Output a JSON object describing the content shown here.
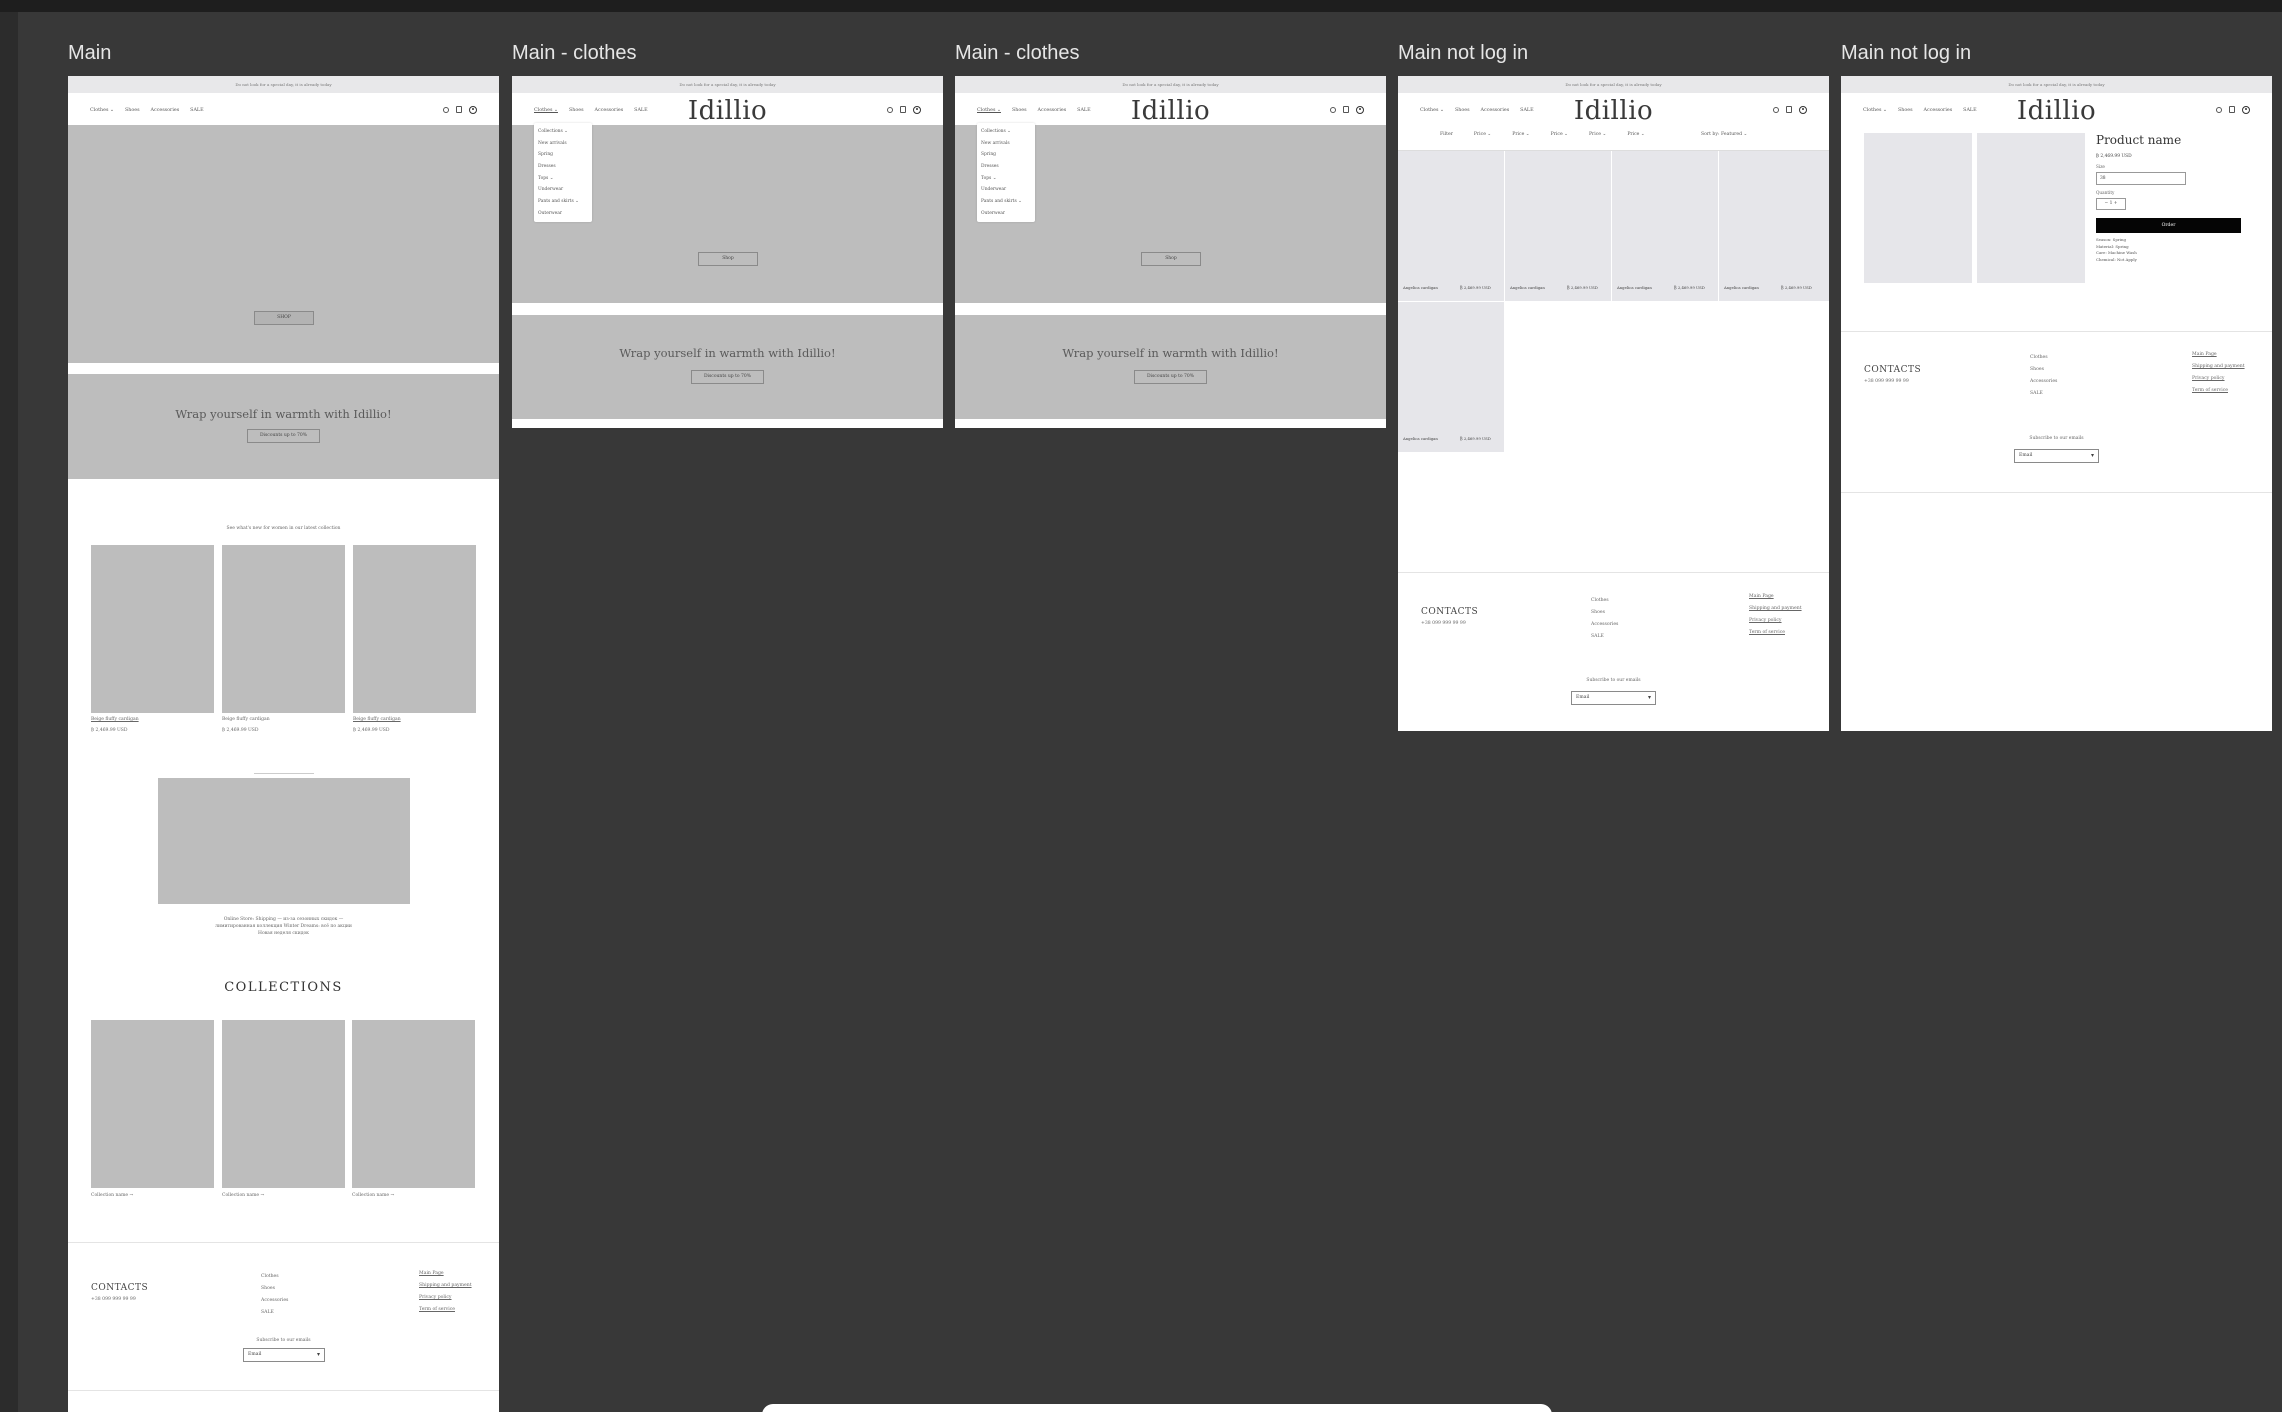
{
  "frames": {
    "main": "Main",
    "clothes1": "Main - clothes",
    "clothes2": "Main - clothes",
    "notlog1": "Main not log in",
    "notlog2": "Main not log in"
  },
  "site": {
    "announcement": "Do not look for a special day, it is already today",
    "logo": "Idillio",
    "nav": [
      "Clothes ⌄",
      "Shoes",
      "Accessories",
      "SALE"
    ]
  },
  "hero": {
    "shop_button": "SHOP",
    "shop_button_alt": "Shop",
    "banner_title": "Wrap yourself in warmth with Idillio!",
    "banner_button": "Discounts up to 70%"
  },
  "main": {
    "latest_caption": "See what's new for women in our latest collection",
    "products": [
      {
        "name": "Beige fluffy cardigan",
        "price": "₿ 2,469.99 USD"
      },
      {
        "name": "Beige fluffy cardigan",
        "price": "₿ 2,469.99 USD"
      },
      {
        "name": "Beige fluffy cardigan",
        "price": "₿ 2,469.99 USD"
      }
    ],
    "promo_text_1": "Online Store: Shipping — из-за сезонных скидок —",
    "promo_text_2": "лимитированная коллекция Winter Dreams: всё по акции",
    "promo_text_3": "Новая неделя скидок",
    "collections_title": "COLLECTIONS",
    "collections": [
      "Collection name →",
      "Collection name →",
      "Collection name →"
    ]
  },
  "dropdown": [
    "Collections ⌄",
    "New arrivals",
    "Spring",
    "Dresses",
    "Tops ⌄",
    "Underwear",
    "Pants and skirts ⌄",
    "Outerwear"
  ],
  "filters": {
    "items": [
      "Filter",
      "Price ⌄",
      "Price ⌄",
      "Price ⌄",
      "Price ⌄",
      "Price ⌄"
    ],
    "sort": "Sort by: Featured ⌄",
    "card_name": "Angelica cardigan",
    "card_price": "₿ 2,469.99 USD"
  },
  "product": {
    "name": "Product name",
    "price": "₿ 2,469.99 USD",
    "size_label": "Size",
    "size_value": "38",
    "quantity_label": "Quantity",
    "quantity_value": "−  1  +",
    "order_button": "Order",
    "details": [
      "Season: Spring",
      "Material: Spring",
      "Care: Machine Wash",
      "Chemical: Not Apply"
    ]
  },
  "footer": {
    "contacts": "CONTACTS",
    "phone": "+38 099 999 99 99",
    "col1": [
      "Clothes",
      "Shoes",
      "Accessories",
      "SALE"
    ],
    "col2": [
      "Main Page",
      "Shipping and payment",
      "Privacy policy",
      "Term of service"
    ],
    "subscribe": "Subscribe to our emails",
    "email": "Email"
  }
}
